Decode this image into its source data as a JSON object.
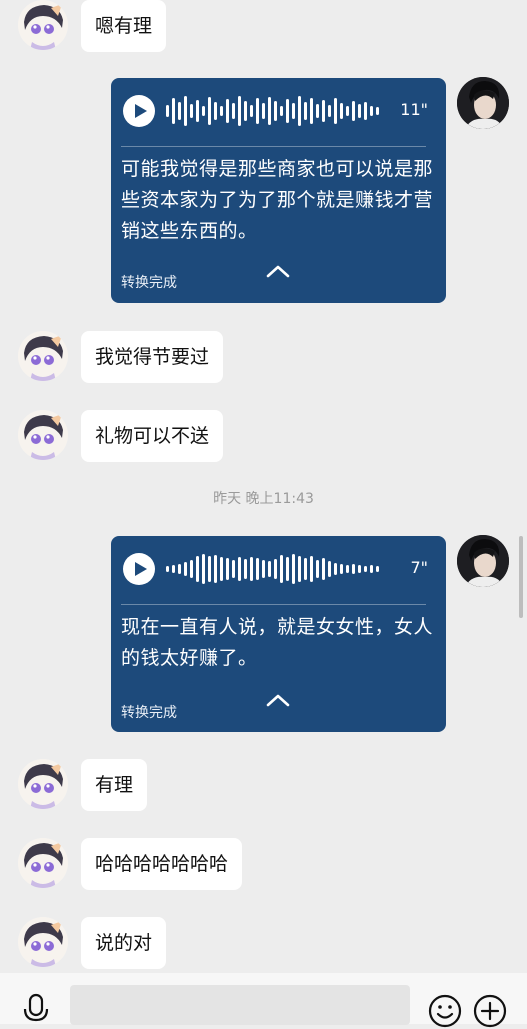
{
  "messages": {
    "m1": "嗯有理",
    "m3": "我觉得节要过",
    "m4": "礼物可以不送",
    "m6": "有理",
    "m7": "哈哈哈哈哈哈哈",
    "m8": "说的对"
  },
  "voice1": {
    "duration": "11\"",
    "transcript": "可能我觉得是那些商家也可以说是那些资本家为了为了那个就是赚钱才营销这些东西的。",
    "status": "转换完成"
  },
  "voice2": {
    "duration": "7\"",
    "transcript": "现在一直有人说，就是女女性，女人的钱太好赚了。",
    "status": "转换完成"
  },
  "timestamp": "昨天 晚上11:43",
  "input": {
    "placeholder": ""
  },
  "colors": {
    "voice_bubble": "#1d4a7b",
    "background": "#ededed",
    "bubble_left": "#ffffff"
  },
  "icons": [
    "microphone-icon",
    "emoji-icon",
    "plus-icon",
    "play-icon",
    "chevron-up-icon"
  ]
}
